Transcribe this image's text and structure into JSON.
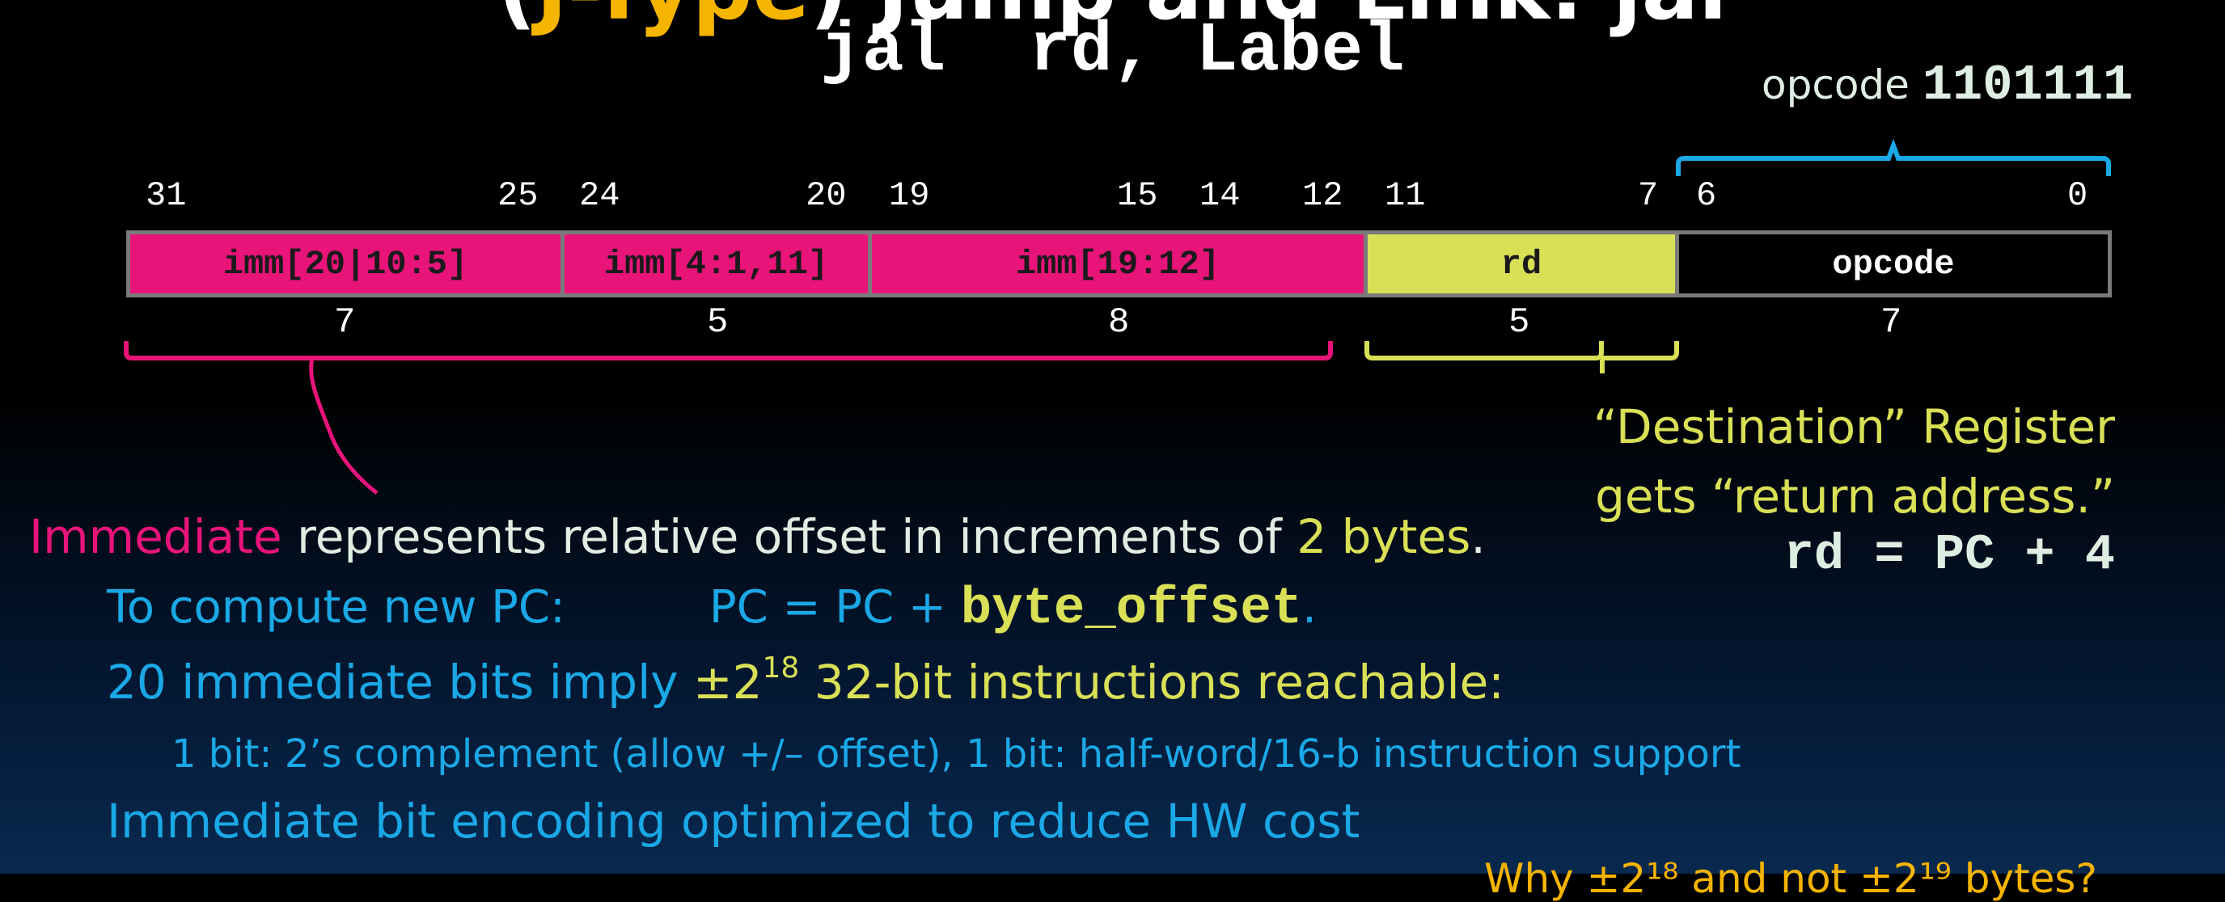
{
  "header": {
    "cut_title_white_1": "(",
    "cut_title_yellow": "J-Type",
    "cut_title_white_2": ") Jump and Link: jal",
    "instruction": "jal  rd, Label"
  },
  "opcode_label": {
    "text": "opcode",
    "bits": "1101111"
  },
  "bit_numbers": [
    "31",
    "25",
    "24",
    "20",
    "19",
    "15",
    "14",
    "12",
    "11",
    "7",
    "6",
    "0"
  ],
  "fields": [
    {
      "label": "imm[20|10:5]",
      "width": "7",
      "color": "#e8147a"
    },
    {
      "label": "imm[4:1,11]",
      "width": "5",
      "color": "#e8147a"
    },
    {
      "label": "imm[19:12]",
      "width": "8",
      "color": "#e8147a"
    },
    {
      "label": "rd",
      "width": "5",
      "color": "#d9e055"
    },
    {
      "label": "opcode",
      "width": "7",
      "color": "#000000"
    }
  ],
  "rd_note": {
    "line1": "“Destination” Register",
    "line2": "gets “return address.”",
    "equation": "rd = PC + 4"
  },
  "body": {
    "l1_pink": "Immediate",
    "l1_text": " represents relative offset in increments of ",
    "l1_yellow": "2 bytes",
    "l1_end": ".",
    "l2_text": "To compute new PC:          PC = PC + ",
    "l2_code": "byte_offset",
    "l2_end": ".",
    "l3_text": "20 immediate bits imply ",
    "l3_pm": "±2",
    "l3_sup": "18",
    "l3_yellow": " 32-bit instructions reachable:",
    "l4": "1 bit: 2’s complement (allow +/– offset), 1 bit: half-word/16-b instruction support",
    "l5": "Immediate bit encoding optimized to reduce HW cost",
    "cut_bottom": "Why ±2¹⁸ and not ±2¹⁹ bytes?"
  },
  "colors": {
    "imm_pink": "#e8147a",
    "rd_yellow": "#d9e055",
    "opcode_cyan": "#1aa8e6",
    "text_cyan": "#1aa8e6",
    "title_yellow": "#f5b400"
  }
}
